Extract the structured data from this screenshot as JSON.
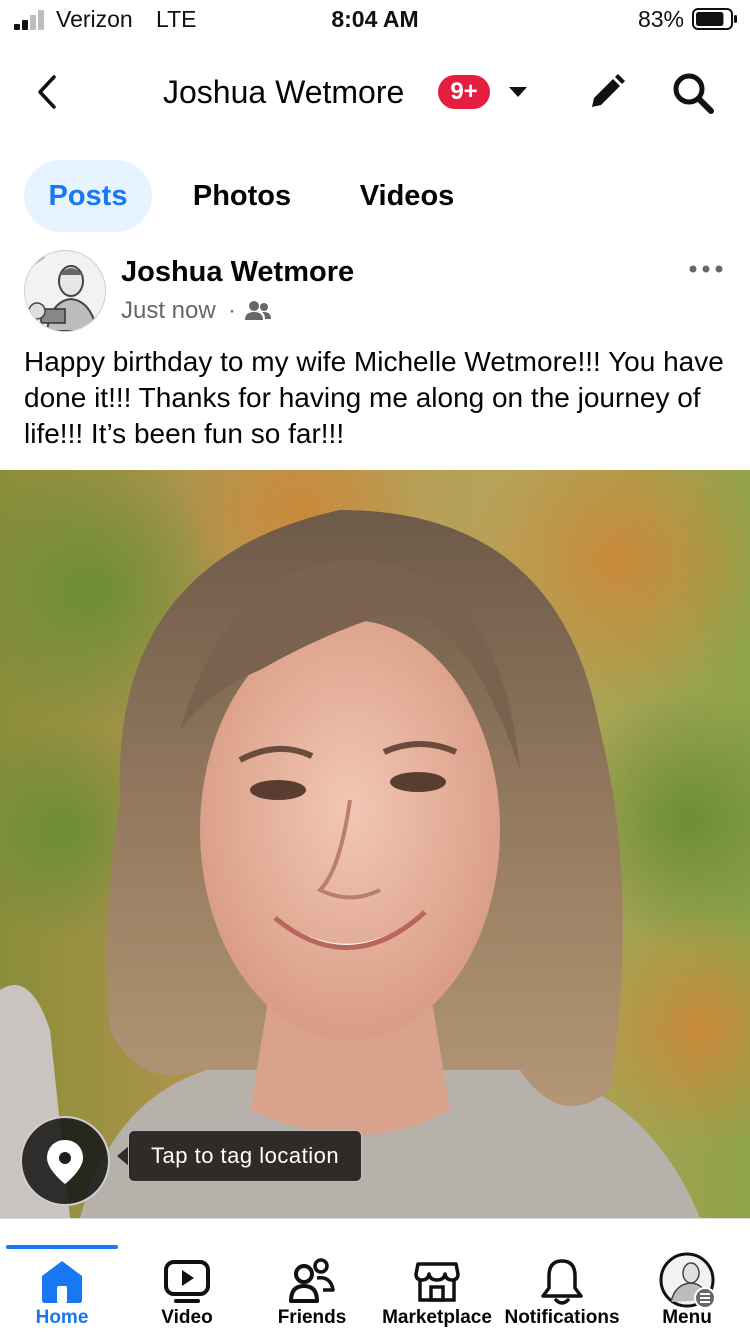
{
  "status_bar": {
    "carrier": "Verizon",
    "network": "LTE",
    "time": "8:04 AM",
    "battery_percent": "83%",
    "battery_level": 0.83
  },
  "header": {
    "title": "Joshua Wetmore",
    "notification_badge": "9+"
  },
  "tabs": [
    {
      "label": "Posts",
      "active": true
    },
    {
      "label": "Photos",
      "active": false
    },
    {
      "label": "Videos",
      "active": false
    }
  ],
  "post": {
    "author": "Joshua Wetmore",
    "timestamp": "Just now",
    "separator": "·",
    "audience_icon": "friends-audience-icon",
    "text": "Happy birthday to my wife Michelle Wetmore!!! You have done it!!! Thanks for having me along on the journey of life!!! It’s been fun so far!!!",
    "location_tooltip": "Tap to tag location"
  },
  "bottom_nav": [
    {
      "label": "Home",
      "icon": "home-icon",
      "active": true
    },
    {
      "label": "Video",
      "icon": "video-icon",
      "active": false
    },
    {
      "label": "Friends",
      "icon": "friends-icon",
      "active": false
    },
    {
      "label": "Marketplace",
      "icon": "marketplace-icon",
      "active": false
    },
    {
      "label": "Notifications",
      "icon": "bell-icon",
      "active": false
    },
    {
      "label": "Menu",
      "icon": "profile-avatar-icon",
      "active": false
    }
  ],
  "colors": {
    "accent": "#1877f2",
    "badge": "#e41e3f",
    "tab_active_bg": "#e7f3ff",
    "secondary_text": "#65676b"
  }
}
